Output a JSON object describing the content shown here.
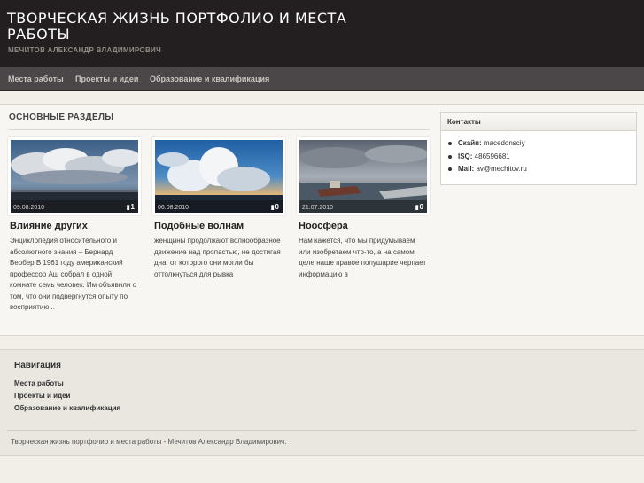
{
  "header": {
    "title": "ТВОРЧЕСКАЯ ЖИЗНЬ ПОРТФОЛИО И МЕСТА РАБОТЫ",
    "subtitle": "МЕЧИТОВ АЛЕКСАНДР ВЛАДИМИРОВИЧ"
  },
  "nav": {
    "items": [
      {
        "label": "Места работы"
      },
      {
        "label": "Проекты и идеи"
      },
      {
        "label": "Образование и квалификация"
      }
    ]
  },
  "main": {
    "section_title": "ОСНОВНЫЕ РАЗДЕЛЫ",
    "posts": [
      {
        "date": "09.08.2010",
        "comments": "1",
        "title": "Влияние других",
        "excerpt": "Энциклопедия относительного и абсолютного знания – Бернард Вербер В 1961 году американский профессор Аш собрал в одной комнате семь человек. Им объявили о том, что они подвергнутся опыту по восприятию..."
      },
      {
        "date": "06.08.2010",
        "comments": "0",
        "title": "Подобные волнам",
        "excerpt": "женщины продолжают волнообразное движение над пропастью, не достигая дна, от которого они могли бы оттолкнуться для рывка"
      },
      {
        "date": "21.07.2010",
        "comments": "0",
        "title": "Ноосфера",
        "excerpt": "Нам кажется, что мы придумываем или изобретаем что-то, а на самом деле наше правое полушарие черпает информацию в"
      }
    ]
  },
  "sidebar": {
    "widget_title": "Контакты",
    "contacts": [
      {
        "label": "Скайп:",
        "value": " macedonsciy"
      },
      {
        "label": "ISQ:",
        "value": " 486596681"
      },
      {
        "label": "Mail:",
        "value": " av@mechitov.ru"
      }
    ]
  },
  "footer": {
    "nav_title": "Навигация",
    "links": [
      {
        "label": "Места работы"
      },
      {
        "label": "Проекты и идеи"
      },
      {
        "label": "Образование и квалификация"
      }
    ],
    "copyright": "Творческая жизнь портфолио и места работы - Мечитов Александр Владимирович."
  },
  "colors": {
    "header_bg": "#231f20",
    "nav_bg": "#4b4748",
    "page_bg": "#f1efe8"
  },
  "icons": {
    "comment": "speech-bubble-icon",
    "bullet": "bullet-dot-icon"
  }
}
